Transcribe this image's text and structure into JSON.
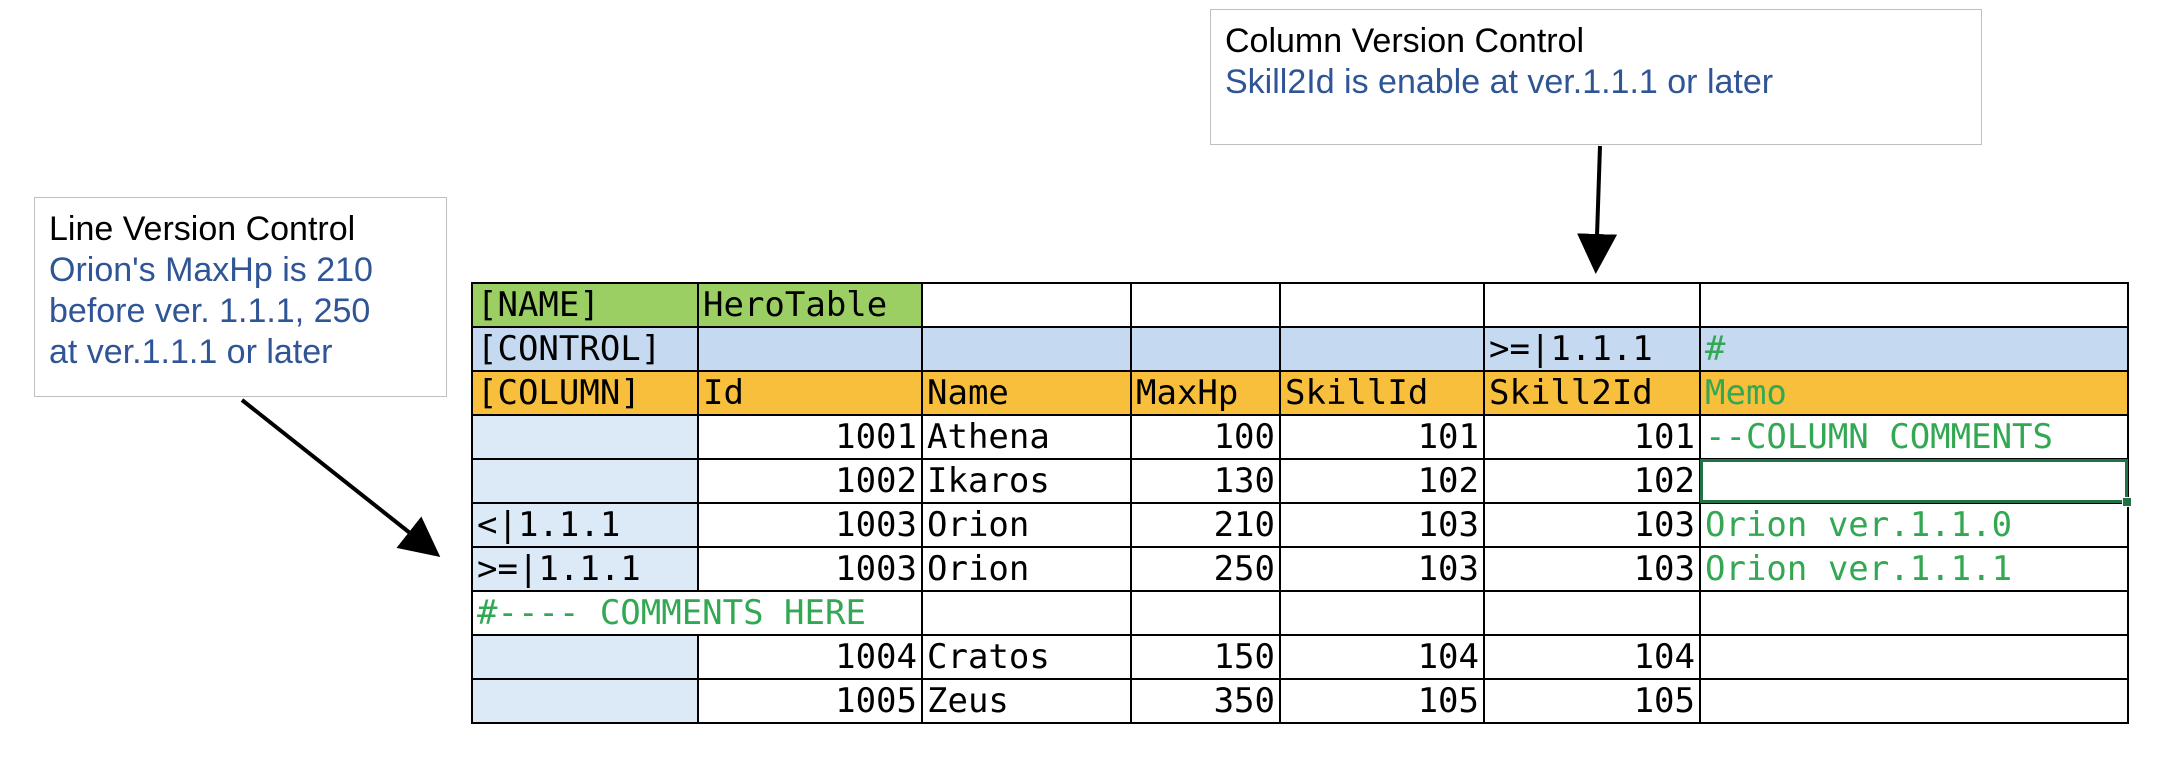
{
  "callout_column": {
    "title": "Column Version Control",
    "text": "Skill2Id is enable at ver.1.1.1 or later"
  },
  "callout_line": {
    "title": "Line Version Control",
    "lines": [
      "Orion's MaxHp is 210",
      "before ver. 1.1.1, 250",
      "at ver.1.1.1 or later"
    ]
  },
  "sheet": {
    "name_row": {
      "label": "[NAME]",
      "value": "HeroTable"
    },
    "control_row": {
      "label": "[CONTROL]",
      "skill2id": ">=|1.1.1",
      "memo": "#"
    },
    "column_row": {
      "label": "[COLUMN]",
      "headers": [
        "Id",
        "Name",
        "MaxHp",
        "SkillId",
        "Skill2Id",
        "Memo"
      ]
    },
    "rows": [
      {
        "control": "",
        "cells": [
          "1001",
          "Athena",
          "100",
          "101",
          "101",
          "--COLUMN COMMENTS"
        ]
      },
      {
        "control": "",
        "cells": [
          "1002",
          "Ikaros",
          "130",
          "102",
          "102",
          ""
        ]
      },
      {
        "control": "<|1.1.1",
        "cells": [
          "1003",
          "Orion",
          "210",
          "103",
          "103",
          "Orion ver.1.1.0"
        ]
      },
      {
        "control": ">=|1.1.1",
        "cells": [
          "1003",
          "Orion",
          "250",
          "103",
          "103",
          "Orion ver.1.1.1"
        ]
      },
      {
        "comment": "#---- COMMENTS HERE"
      },
      {
        "control": "",
        "cells": [
          "1004",
          "Cratos",
          "150",
          "104",
          "104",
          ""
        ]
      },
      {
        "control": "",
        "cells": [
          "1005",
          "Zeus",
          "350",
          "105",
          "105",
          ""
        ]
      }
    ]
  },
  "colors": {
    "name_bg": "#9bcf63",
    "control_bg": "#c5d9f1",
    "column_bg": "#f8bf3d",
    "comment_text": "#33a852",
    "callout_text": "#2f5597"
  }
}
